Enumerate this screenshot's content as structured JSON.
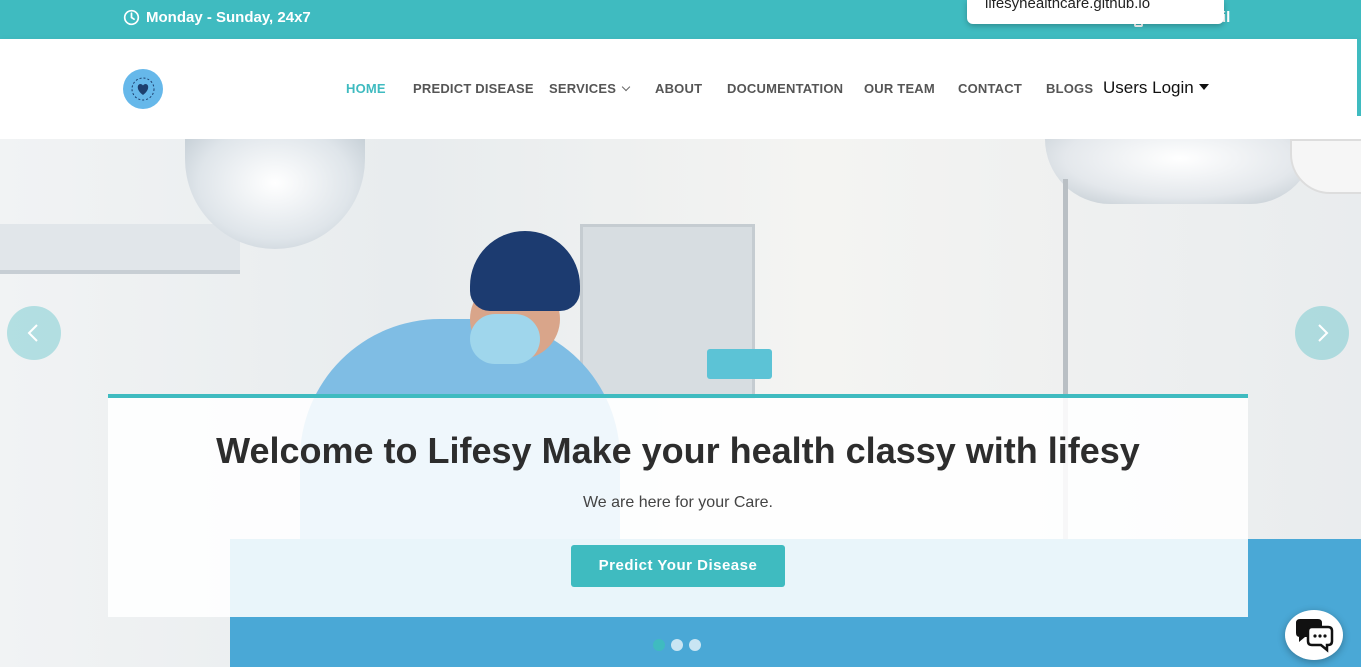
{
  "topbar": {
    "hours": "Monday - Sunday, 24x7",
    "hours_icon": "clock-icon",
    "right_fragment": "il"
  },
  "url_popup": {
    "text": "lifesyhealthcare.github.io"
  },
  "header": {
    "logo_icon": "heart-logo-icon",
    "nav": [
      {
        "label": "HOME",
        "active": true
      },
      {
        "label": "PREDICT DISEASE"
      },
      {
        "label": "SERVICES",
        "has_dropdown": true
      },
      {
        "label": "ABOUT"
      },
      {
        "label": "DOCUMENTATION"
      },
      {
        "label": "OUR TEAM"
      },
      {
        "label": "CONTACT"
      },
      {
        "label": "BLOGS"
      }
    ],
    "users_login": "Users Login"
  },
  "hero": {
    "title": "Welcome to Lifesy Make your health classy with lifesy",
    "subtitle": "We are here for your Care.",
    "button": "Predict Your Disease",
    "prev_icon": "chevron-left-icon",
    "next_icon": "chevron-right-icon",
    "slide_count": 3,
    "active_slide": 1
  },
  "chat": {
    "icon": "chat-bubbles-icon"
  },
  "colors": {
    "accent": "#3fbbc0",
    "nav_text": "#555555",
    "title_text": "#2d2d2d"
  }
}
